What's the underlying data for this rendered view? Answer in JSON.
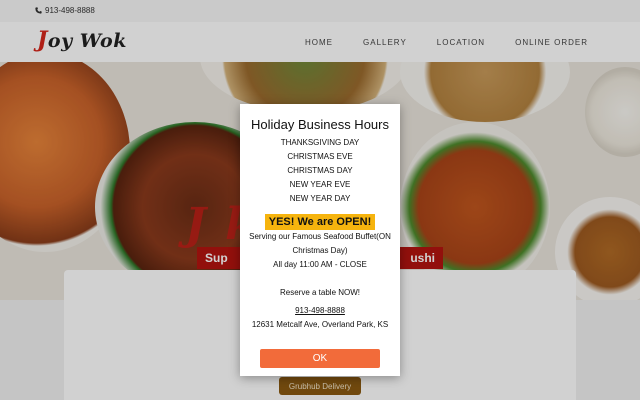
{
  "topbar": {
    "phone": "913-498-8888"
  },
  "header": {
    "logo_first": "J",
    "logo_rest": "oy Wok",
    "nav": [
      "HOME",
      "GALLERY",
      "LOCATION",
      "ONLINE ORDER"
    ]
  },
  "hero": {
    "title": "J              k",
    "banner_left": "Sup",
    "banner_right": "ushi"
  },
  "grubhub_label": "Grubhub Delivery",
  "modal": {
    "title": "Holiday Business Hours",
    "days": [
      "THANKSGIVING DAY",
      "CHRISTMAS EVE",
      "CHRISTMAS DAY",
      "NEW YEAR EVE",
      "NEW YEAR DAY"
    ],
    "open_label": "YES! We are OPEN!",
    "serving_line1": "Serving our Famous Seafood Buffet(ON",
    "serving_line2": "Christmas Day)",
    "hours": "All day 11:00 AM - CLOSE",
    "reserve": "Reserve a table NOW!",
    "phone": "913-498-8888",
    "address": "12631 Metcalf Ave, Overland Park, KS",
    "ok_label": "OK"
  },
  "colors": {
    "accent": "#f26b3a",
    "badge": "#f6b40e",
    "brand_red": "#d6261c"
  }
}
